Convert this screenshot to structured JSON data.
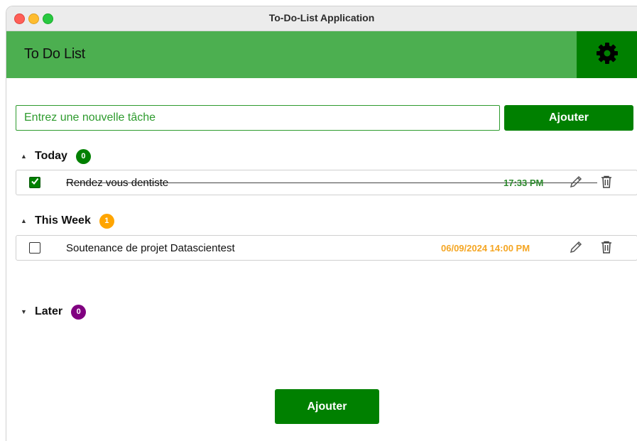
{
  "window": {
    "title": "To-Do-List Application"
  },
  "header": {
    "title": "To Do List",
    "settings_icon": "gear-icon"
  },
  "new_task": {
    "placeholder": "Entrez une nouvelle tâche",
    "value": "",
    "add_label": "Ajouter"
  },
  "sections": {
    "today": {
      "label": "Today",
      "count": "0",
      "badge_color": "#008000",
      "expanded": true,
      "tasks": [
        {
          "text": "Rendez vous dentiste",
          "time": "17:33 PM",
          "completed": true,
          "time_color": "#2e8b2e"
        }
      ]
    },
    "this_week": {
      "label": "This Week",
      "count": "1",
      "badge_color": "#ffa500",
      "expanded": true,
      "tasks": [
        {
          "text": "Soutenance de projet Datascientest",
          "time": "06/09/2024 14:00 PM",
          "completed": false,
          "time_color": "#f5a623"
        }
      ]
    },
    "later": {
      "label": "Later",
      "count": "0",
      "badge_color": "#800080",
      "expanded": false
    }
  },
  "footer": {
    "add_label": "Ajouter"
  },
  "colors": {
    "header_bg": "#4caf50",
    "primary": "#008000"
  }
}
